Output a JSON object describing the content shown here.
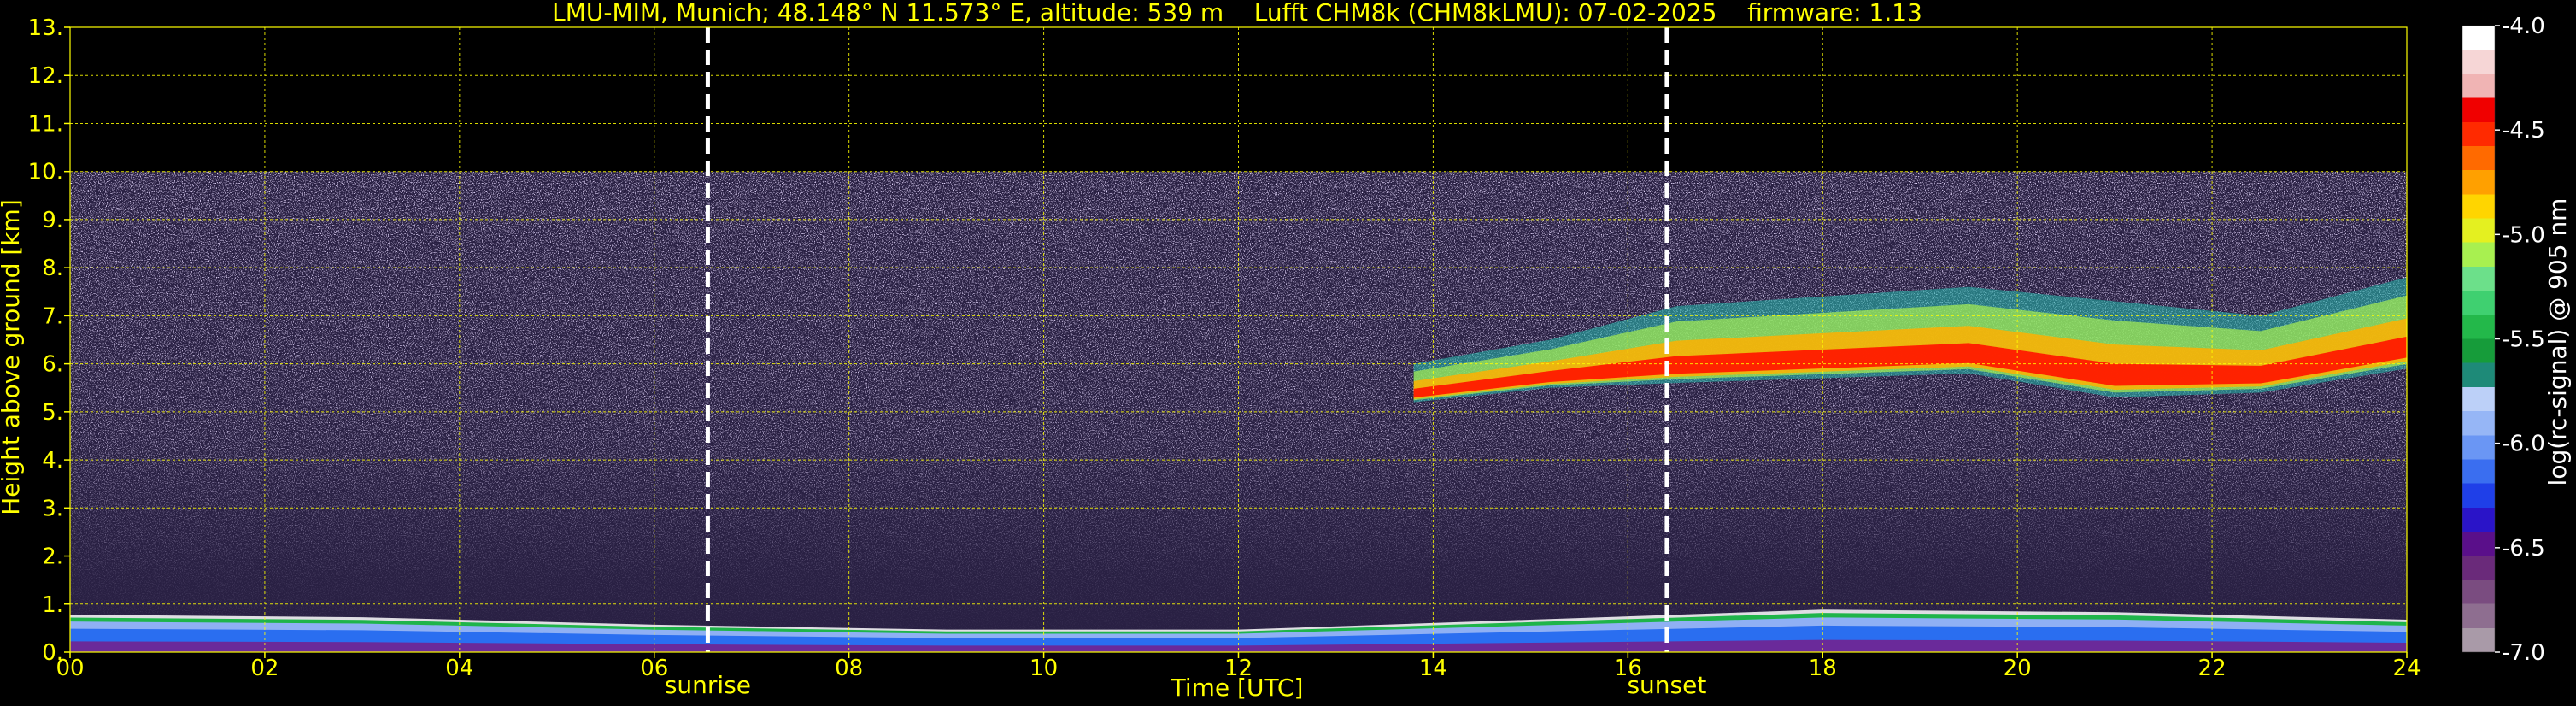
{
  "chart_data": {
    "type": "heatmap",
    "title": "LMU-MIM, Munich; 48.148° N 11.573° E, altitude: 539 m    Lufft CHM8k (CHM8kLMU): 07-02-2025    firmware: 1.13",
    "xlabel": "Time [UTC]",
    "ylabel": "Height above ground [km]",
    "xlim": [
      0,
      24
    ],
    "ylim": [
      0,
      13
    ],
    "x_ticks": [
      "00",
      "02",
      "04",
      "06",
      "08",
      "10",
      "12",
      "14",
      "16",
      "18",
      "20",
      "22",
      "24"
    ],
    "y_ticks": [
      "0.",
      "1.",
      "2.",
      "3.",
      "4.",
      "5.",
      "6.",
      "7.",
      "8.",
      "9.",
      "10.",
      "11.",
      "12.",
      "13."
    ],
    "grid": true,
    "grid_color": "#ffff00",
    "text_color": "#ffff00",
    "background": "#000000",
    "data_top_km": 10,
    "events": [
      {
        "label": "sunrise",
        "time_utc": 6.55
      },
      {
        "label": "sunset",
        "time_utc": 16.4
      }
    ],
    "boundary_layer": [
      {
        "time_utc": 0,
        "height_km": 0.75
      },
      {
        "time_utc": 3,
        "height_km": 0.7
      },
      {
        "time_utc": 6,
        "height_km": 0.55
      },
      {
        "time_utc": 9,
        "height_km": 0.45
      },
      {
        "time_utc": 12,
        "height_km": 0.45
      },
      {
        "time_utc": 15,
        "height_km": 0.65
      },
      {
        "time_utc": 18,
        "height_km": 0.85
      },
      {
        "time_utc": 21,
        "height_km": 0.8
      },
      {
        "time_utc": 24,
        "height_km": 0.65
      }
    ],
    "cloud_layer": [
      {
        "time_utc": 13.8,
        "base_km": 5.2,
        "top_km": 6.0
      },
      {
        "time_utc": 15.2,
        "base_km": 5.5,
        "top_km": 6.5
      },
      {
        "time_utc": 16.5,
        "base_km": 5.6,
        "top_km": 7.2
      },
      {
        "time_utc": 18.0,
        "base_km": 5.7,
        "top_km": 7.4
      },
      {
        "time_utc": 19.5,
        "base_km": 5.8,
        "top_km": 7.6
      },
      {
        "time_utc": 21.0,
        "base_km": 5.3,
        "top_km": 7.3
      },
      {
        "time_utc": 22.5,
        "base_km": 5.4,
        "top_km": 7.0
      },
      {
        "time_utc": 24.0,
        "base_km": 5.9,
        "top_km": 7.8
      }
    ],
    "colorbar": {
      "label": "log(rc-signal) @ 905 nm",
      "min": -7.0,
      "max": -4.0,
      "ticks": [
        "-4.0",
        "-4.5",
        "-5.0",
        "-5.5",
        "-6.0",
        "-6.5",
        "-7.0"
      ],
      "colors": [
        "#a99aa8",
        "#8e6e90",
        "#7a4c80",
        "#6a2a7a",
        "#5a0f8a",
        "#2a14c8",
        "#1f3fe8",
        "#3a6ef0",
        "#6a96f4",
        "#96b6f6",
        "#bcd0f8",
        "#1e8a78",
        "#169c3a",
        "#23b84a",
        "#3fd070",
        "#6ce08a",
        "#a8f050",
        "#e4f020",
        "#ffd500",
        "#ffa000",
        "#ff6a00",
        "#ff2a00",
        "#f00000",
        "#f0b4b4",
        "#f6d6d6",
        "#ffffff"
      ]
    }
  }
}
